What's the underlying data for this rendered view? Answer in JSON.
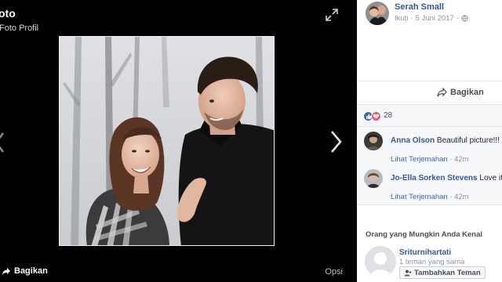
{
  "viewer": {
    "title": "oto",
    "subtitle": "Foto Profil",
    "share_label": "Bagikan",
    "options_label": "Opsi"
  },
  "sidebar": {
    "author": {
      "name": "Serah Small",
      "follow_label": "Ikuti",
      "separator": "·",
      "date": "5 Juni 2017",
      "separator2": "·"
    },
    "share_label": "Bagikan",
    "reaction_count": "28",
    "comments": [
      {
        "author": "Anna Olson",
        "text": "Beautiful picture!!!",
        "translate_label": "Lihat Terjemahan",
        "separator": "·",
        "time": "42m"
      },
      {
        "author": "Jo-Ella Sorken Stevens",
        "text": "Love it",
        "translate_label": "Lihat Terjemahan",
        "separator": "·",
        "time": "42m"
      }
    ],
    "people_you_may_know": {
      "title": "Orang yang Mungkin Anda Kenal",
      "name": "Sriturnihartati",
      "mutual": "1 teman yang sama",
      "add_label": "Tambahkan Teman"
    }
  },
  "colors": {
    "link_blue": "#365899",
    "like_blue": "#4267b2",
    "love_red": "#f25268",
    "viewer_bg": "#000000"
  },
  "icons": [
    "expand-icon",
    "chevron-left-icon",
    "chevron-right-icon",
    "share-arrow-icon",
    "globe-icon",
    "like-reaction-icon",
    "love-reaction-icon",
    "add-friend-icon"
  ]
}
